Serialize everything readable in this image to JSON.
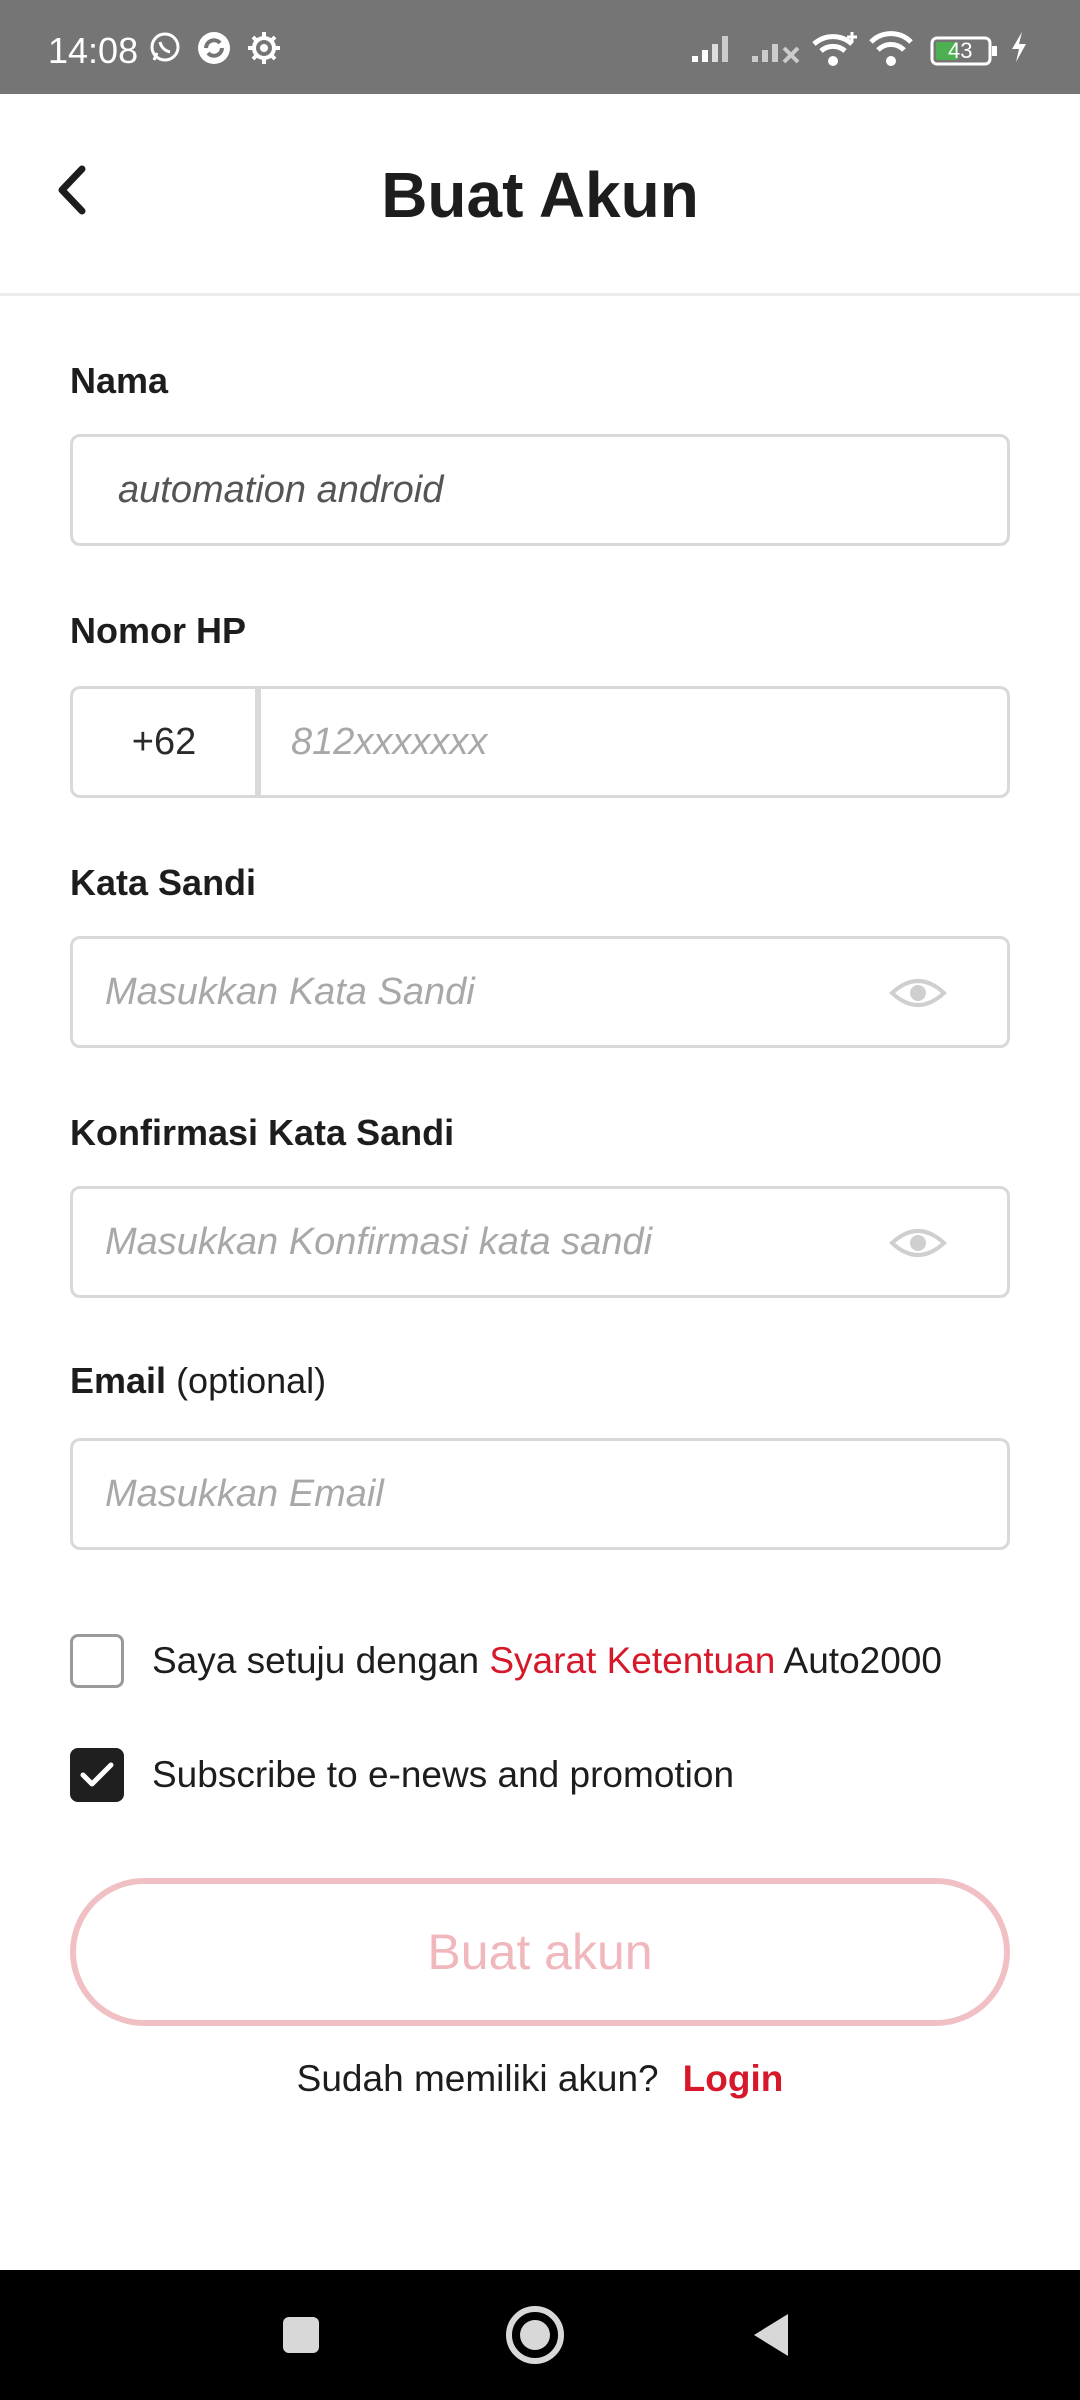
{
  "status_bar": {
    "time": "14:08",
    "battery": "43",
    "icons": [
      "whatsapp-icon",
      "sync-icon",
      "settings-icon",
      "signal-icon",
      "signal-no-service-icon",
      "wifi-plus-icon",
      "wifi-icon",
      "battery-icon",
      "charging-icon"
    ]
  },
  "header": {
    "title": "Buat Akun",
    "back_icon": "chevron-left-icon"
  },
  "form": {
    "name": {
      "label": "Nama",
      "value": "automation android",
      "placeholder": ""
    },
    "phone": {
      "label": "Nomor HP",
      "country_code": "+62",
      "placeholder": "812xxxxxxx"
    },
    "password": {
      "label": "Kata Sandi",
      "placeholder": "Masukkan Kata Sandi",
      "icon": "eye-icon"
    },
    "confirm_password": {
      "label": "Konfirmasi Kata Sandi",
      "placeholder": "Masukkan Konfirmasi kata sandi",
      "icon": "eye-icon"
    },
    "email": {
      "label": "Email",
      "label_suffix": "(optional)",
      "placeholder": "Masukkan Email"
    }
  },
  "agreements": {
    "terms": {
      "prefix": "Saya setuju dengan ",
      "link": "Syarat Ketentuan",
      "suffix": " Auto2000",
      "checked": false
    },
    "subscribe": {
      "text": "Subscribe to e-news and promotion",
      "checked": true
    }
  },
  "submit": {
    "label": "Buat akun"
  },
  "login_prompt": {
    "text": "Sudah memiliki akun?",
    "link": "Login"
  },
  "nav_bar": {
    "icons": [
      "recents-square-icon",
      "home-circle-icon",
      "back-triangle-icon"
    ]
  },
  "colors": {
    "accent": "#d6182a",
    "button_disabled": "#f0b8bd",
    "status_bar": "#757575",
    "border": "#d9d9d9"
  }
}
